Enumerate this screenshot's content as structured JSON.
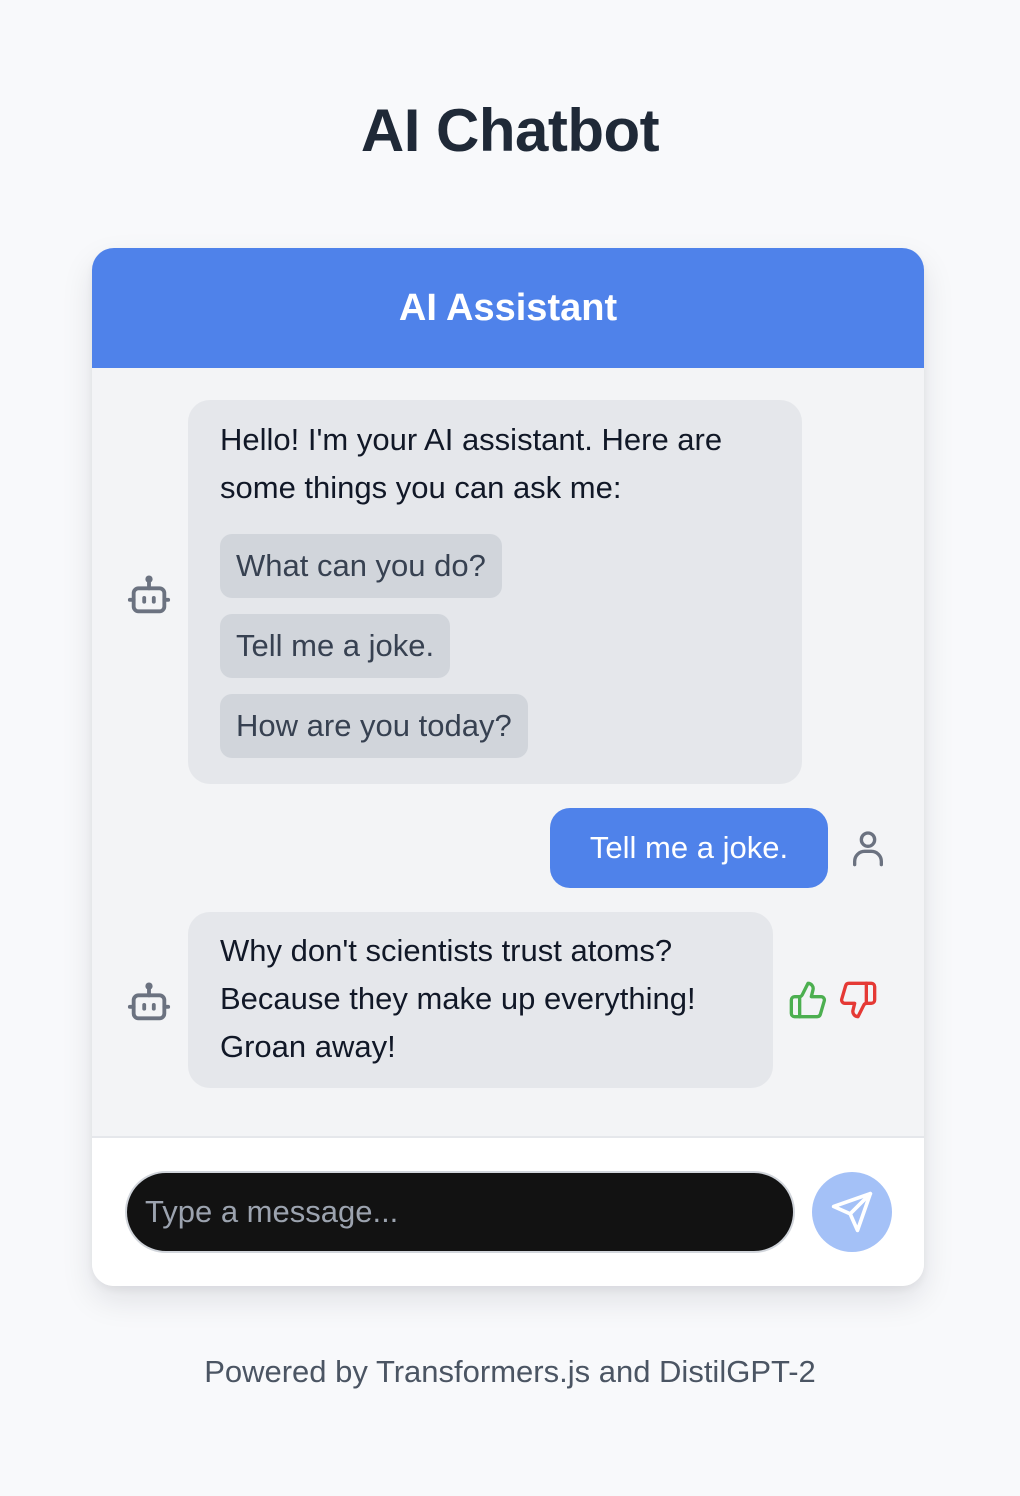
{
  "page": {
    "title": "AI Chatbot",
    "footer": "Powered by Transformers.js and DistilGPT-2"
  },
  "chat": {
    "header_title": "AI Assistant",
    "messages": [
      {
        "role": "bot",
        "text": "Hello! I'm your AI assistant. Here are some things you can ask me:",
        "suggestions": [
          "What can you do?",
          "Tell me a joke.",
          "How are you today?"
        ]
      },
      {
        "role": "user",
        "text": "Tell me a joke."
      },
      {
        "role": "bot",
        "text": "Why don't scientists trust atoms? Because they make up everything! Groan away!",
        "feedback": [
          "thumbs-up-icon",
          "thumbs-down-icon"
        ]
      }
    ],
    "input": {
      "placeholder": "Type a message...",
      "value": ""
    },
    "send_icon": "send-icon"
  },
  "colors": {
    "accent": "#4f82ea",
    "send_button_disabled": "#a4c1f7",
    "bot_bubble": "#e5e7eb",
    "thumbs_up": "#4caf50",
    "thumbs_down": "#e53935"
  }
}
